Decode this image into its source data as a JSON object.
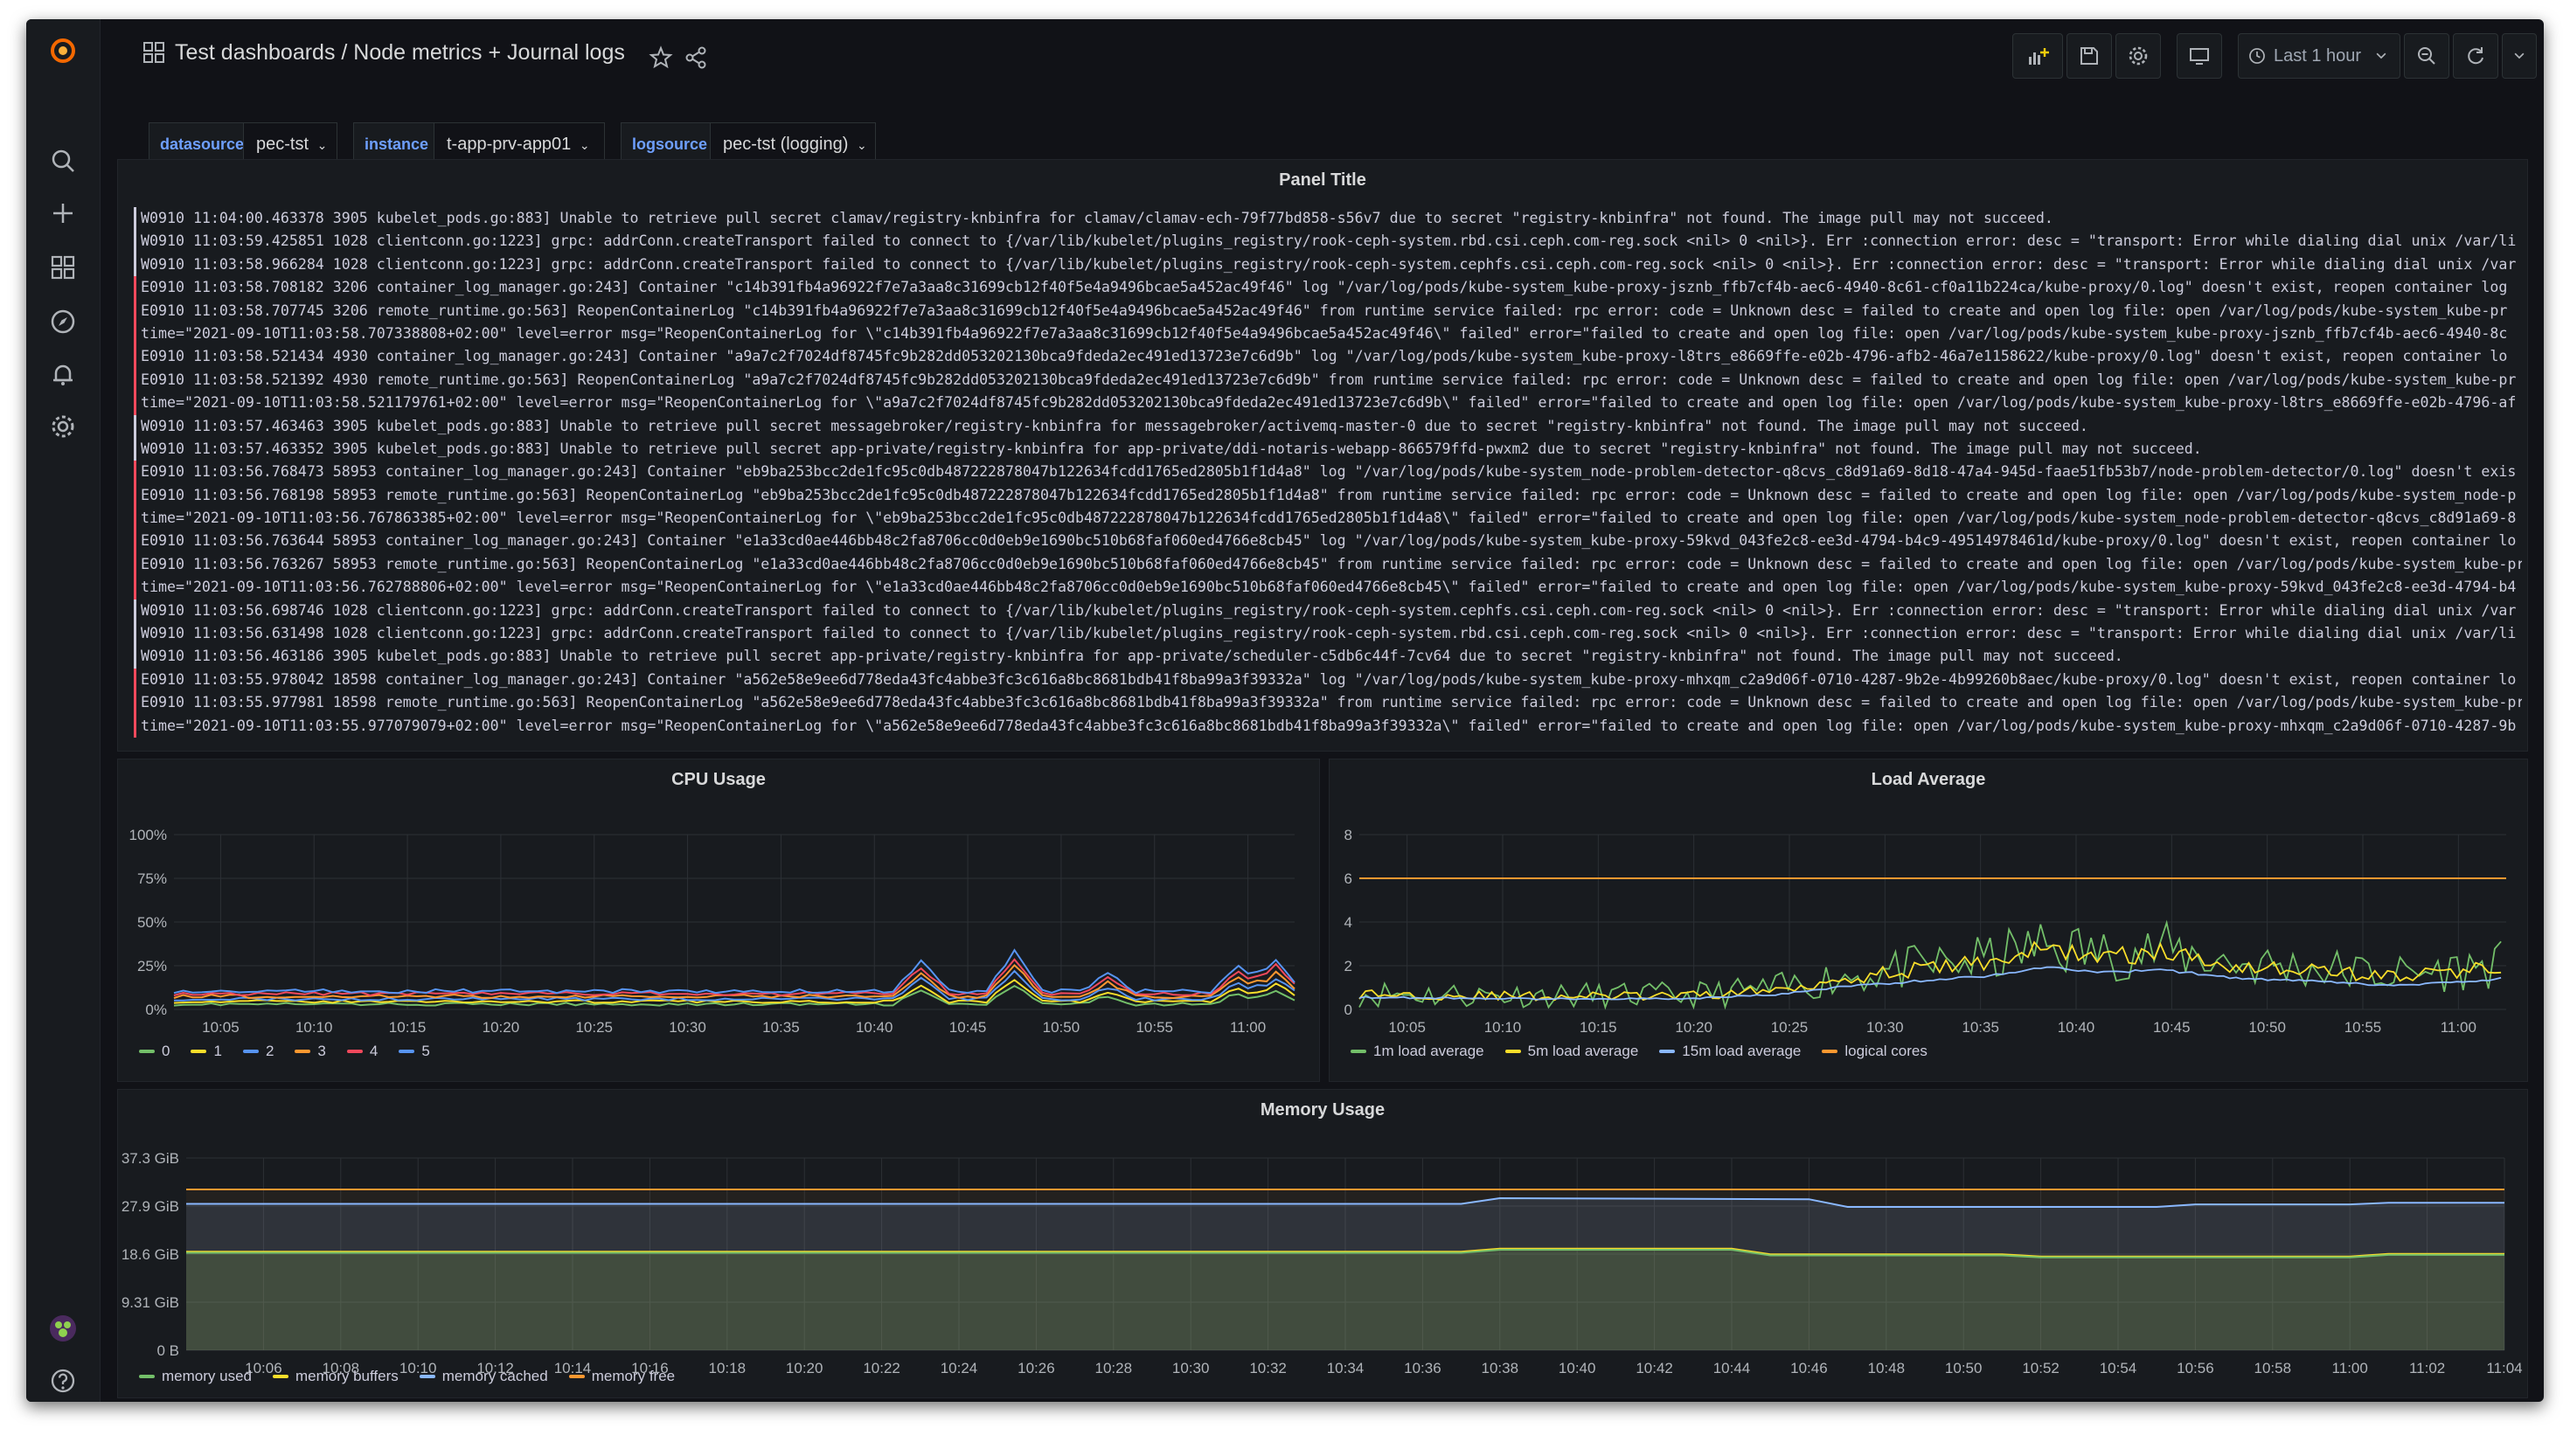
{
  "header": {
    "breadcrumb": "Test dashboards / Node metrics + Journal logs",
    "time_range_label": "Last 1 hour"
  },
  "icons": {
    "logo": "grafana-logo-icon",
    "search": "search-icon",
    "create": "plus-icon",
    "dashboards": "dashboards-grid-icon",
    "explore": "compass-icon",
    "alerting": "bell-icon",
    "configuration": "gear-icon",
    "profile": "avatar",
    "help": "help-icon"
  },
  "variables": [
    {
      "label": "datasource",
      "value": "pec-tst"
    },
    {
      "label": "instance",
      "value": "t-app-prv-app01"
    },
    {
      "label": "logsource",
      "value": "pec-tst (logging)"
    }
  ],
  "logs_panel": {
    "title": "Panel Title",
    "lines": [
      {
        "level": "warn",
        "text": "W0910 11:04:00.463378 3905 kubelet_pods.go:883] Unable to retrieve pull secret clamav/registry-knbinfra for clamav/clamav-ech-79f77bd858-s56v7 due to secret \"registry-knbinfra\" not found. The image pull may not succeed."
      },
      {
        "level": "warn",
        "text": "W0910 11:03:59.425851 1028 clientconn.go:1223] grpc: addrConn.createTransport failed to connect to {/var/lib/kubelet/plugins_registry/rook-ceph-system.rbd.csi.ceph.com-reg.sock <nil> 0 <nil>}. Err :connection error: desc = \"transport: Error while dialing dial unix /var/li"
      },
      {
        "level": "warn",
        "text": "W0910 11:03:58.966284 1028 clientconn.go:1223] grpc: addrConn.createTransport failed to connect to {/var/lib/kubelet/plugins_registry/rook-ceph-system.cephfs.csi.ceph.com-reg.sock <nil> 0 <nil>}. Err :connection error: desc = \"transport: Error while dialing dial unix /var"
      },
      {
        "level": "error",
        "text": "E0910 11:03:58.708182 3206 container_log_manager.go:243] Container \"c14b391fb4a96922f7e7a3aa8c31699cb12f40f5e4a9496bcae5a452ac49f46\" log \"/var/log/pods/kube-system_kube-proxy-jsznb_ffb7cf4b-aec6-4940-8c61-cf0a11b224ca/kube-proxy/0.log\" doesn't exist, reopen container log"
      },
      {
        "level": "error",
        "text": "E0910 11:03:58.707745 3206 remote_runtime.go:563] ReopenContainerLog \"c14b391fb4a96922f7e7a3aa8c31699cb12f40f5e4a9496bcae5a452ac49f46\" from runtime service failed: rpc error: code = Unknown desc = failed to create and open log file: open /var/log/pods/kube-system_kube-pr"
      },
      {
        "level": "error",
        "text": "time=\"2021-09-10T11:03:58.707338808+02:00\" level=error msg=\"ReopenContainerLog for \\\"c14b391fb4a96922f7e7a3aa8c31699cb12f40f5e4a9496bcae5a452ac49f46\\\" failed\" error=\"failed to create and open log file: open /var/log/pods/kube-system_kube-proxy-jsznb_ffb7cf4b-aec6-4940-8c"
      },
      {
        "level": "error",
        "text": "E0910 11:03:58.521434 4930 container_log_manager.go:243] Container \"a9a7c2f7024df8745fc9b282dd053202130bca9fdeda2ec491ed13723e7c6d9b\" log \"/var/log/pods/kube-system_kube-proxy-l8trs_e8669ffe-e02b-4796-afb2-46a7e1158622/kube-proxy/0.log\" doesn't exist, reopen container lo"
      },
      {
        "level": "error",
        "text": "E0910 11:03:58.521392 4930 remote_runtime.go:563] ReopenContainerLog \"a9a7c2f7024df8745fc9b282dd053202130bca9fdeda2ec491ed13723e7c6d9b\" from runtime service failed: rpc error: code = Unknown desc = failed to create and open log file: open /var/log/pods/kube-system_kube-pr"
      },
      {
        "level": "error",
        "text": "time=\"2021-09-10T11:03:58.521179761+02:00\" level=error msg=\"ReopenContainerLog for \\\"a9a7c2f7024df8745fc9b282dd053202130bca9fdeda2ec491ed13723e7c6d9b\\\" failed\" error=\"failed to create and open log file: open /var/log/pods/kube-system_kube-proxy-l8trs_e8669ffe-e02b-4796-af"
      },
      {
        "level": "warn",
        "text": "W0910 11:03:57.463463 3905 kubelet_pods.go:883] Unable to retrieve pull secret messagebroker/registry-knbinfra for messagebroker/activemq-master-0 due to secret \"registry-knbinfra\" not found. The image pull may not succeed."
      },
      {
        "level": "warn",
        "text": "W0910 11:03:57.463352 3905 kubelet_pods.go:883] Unable to retrieve pull secret app-private/registry-knbinfra for app-private/ddi-notaris-webapp-866579ffd-pwxm2 due to secret \"registry-knbinfra\" not found. The image pull may not succeed."
      },
      {
        "level": "error",
        "text": "E0910 11:03:56.768473 58953 container_log_manager.go:243] Container \"eb9ba253bcc2de1fc95c0db487222878047b122634fcdd1765ed2805b1f1d4a8\" log \"/var/log/pods/kube-system_node-problem-detector-q8cvs_c8d91a69-8d18-47a4-945d-faae51fb53b7/node-problem-detector/0.log\" doesn't exis"
      },
      {
        "level": "error",
        "text": "E0910 11:03:56.768198 58953 remote_runtime.go:563] ReopenContainerLog \"eb9ba253bcc2de1fc95c0db487222878047b122634fcdd1765ed2805b1f1d4a8\" from runtime service failed: rpc error: code = Unknown desc = failed to create and open log file: open /var/log/pods/kube-system_node-p"
      },
      {
        "level": "error",
        "text": "time=\"2021-09-10T11:03:56.767863385+02:00\" level=error msg=\"ReopenContainerLog for \\\"eb9ba253bcc2de1fc95c0db487222878047b122634fcdd1765ed2805b1f1d4a8\\\" failed\" error=\"failed to create and open log file: open /var/log/pods/kube-system_node-problem-detector-q8cvs_c8d91a69-8"
      },
      {
        "level": "error",
        "text": "E0910 11:03:56.763644 58953 container_log_manager.go:243] Container \"e1a33cd0ae446bb48c2fa8706cc0d0eb9e1690bc510b68faf060ed4766e8cb45\" log \"/var/log/pods/kube-system_kube-proxy-59kvd_043fe2c8-ee3d-4794-b4c9-49514978461d/kube-proxy/0.log\" doesn't exist, reopen container lo"
      },
      {
        "level": "error",
        "text": "E0910 11:03:56.763267 58953 remote_runtime.go:563] ReopenContainerLog \"e1a33cd0ae446bb48c2fa8706cc0d0eb9e1690bc510b68faf060ed4766e8cb45\" from runtime service failed: rpc error: code = Unknown desc = failed to create and open log file: open /var/log/pods/kube-system_kube-pr"
      },
      {
        "level": "error",
        "text": "time=\"2021-09-10T11:03:56.762788806+02:00\" level=error msg=\"ReopenContainerLog for \\\"e1a33cd0ae446bb48c2fa8706cc0d0eb9e1690bc510b68faf060ed4766e8cb45\\\" failed\" error=\"failed to create and open log file: open /var/log/pods/kube-system_kube-proxy-59kvd_043fe2c8-ee3d-4794-b4"
      },
      {
        "level": "warn",
        "text": "W0910 11:03:56.698746 1028 clientconn.go:1223] grpc: addrConn.createTransport failed to connect to {/var/lib/kubelet/plugins_registry/rook-ceph-system.cephfs.csi.ceph.com-reg.sock <nil> 0 <nil>}. Err :connection error: desc = \"transport: Error while dialing dial unix /var"
      },
      {
        "level": "warn",
        "text": "W0910 11:03:56.631498 1028 clientconn.go:1223] grpc: addrConn.createTransport failed to connect to {/var/lib/kubelet/plugins_registry/rook-ceph-system.rbd.csi.ceph.com-reg.sock <nil> 0 <nil>}. Err :connection error: desc = \"transport: Error while dialing dial unix /var/li"
      },
      {
        "level": "warn",
        "text": "W0910 11:03:56.463186 3905 kubelet_pods.go:883] Unable to retrieve pull secret app-private/registry-knbinfra for app-private/scheduler-c5db6c44f-7cv64 due to secret \"registry-knbinfra\" not found. The image pull may not succeed."
      },
      {
        "level": "error",
        "text": "E0910 11:03:55.978042 18598 container_log_manager.go:243] Container \"a562e58e9ee6d778eda43fc4abbe3fc3c616a8bc8681bdb41f8ba99a3f39332a\" log \"/var/log/pods/kube-system_kube-proxy-mhxqm_c2a9d06f-0710-4287-9b2e-4b99260b8aec/kube-proxy/0.log\" doesn't exist, reopen container lo"
      },
      {
        "level": "error",
        "text": "E0910 11:03:55.977981 18598 remote_runtime.go:563] ReopenContainerLog \"a562e58e9ee6d778eda43fc4abbe3fc3c616a8bc8681bdb41f8ba99a3f39332a\" from runtime service failed: rpc error: code = Unknown desc = failed to create and open log file: open /var/log/pods/kube-system_kube-pr"
      },
      {
        "level": "error",
        "text": "time=\"2021-09-10T11:03:55.977079079+02:00\" level=error msg=\"ReopenContainerLog for \\\"a562e58e9ee6d778eda43fc4abbe3fc3c616a8bc8681bdb41f8ba99a3f39332a\\\" failed\" error=\"failed to create and open log file: open /var/log/pods/kube-system_kube-proxy-mhxqm_c2a9d06f-0710-4287-9b"
      }
    ]
  },
  "chart_data": [
    {
      "type": "line",
      "title": "CPU Usage",
      "x_ticks": [
        "10:05",
        "10:10",
        "10:15",
        "10:20",
        "10:25",
        "10:30",
        "10:35",
        "10:40",
        "10:45",
        "10:50",
        "10:55",
        "11:00"
      ],
      "x_range": [
        1,
        61
      ],
      "y_ticks": [
        "0%",
        "25%",
        "50%",
        "75%",
        "100%"
      ],
      "ylim": [
        0,
        100
      ],
      "series": [
        {
          "name": "0",
          "color": "#73bf69",
          "base": 3,
          "jitter": 0.8
        },
        {
          "name": "1",
          "color": "#fade2a",
          "base": 4.5,
          "jitter": 0.8
        },
        {
          "name": "2",
          "color": "#5794f2",
          "base": 6,
          "jitter": 0.9
        },
        {
          "name": "3",
          "color": "#ff9830",
          "base": 7.5,
          "jitter": 1
        },
        {
          "name": "4",
          "color": "#f2495c",
          "base": 9,
          "jitter": 1
        },
        {
          "name": "5",
          "color": "#5794f2",
          "base": 10.5,
          "jitter": 1.1
        }
      ],
      "spikes": [
        [
          41,
          17
        ],
        [
          46,
          23
        ],
        [
          51,
          10
        ],
        [
          58,
          14
        ],
        [
          60,
          18
        ]
      ],
      "legend": [
        "0",
        "1",
        "2",
        "3",
        "4",
        "5"
      ]
    },
    {
      "type": "line",
      "title": "Load Average",
      "x_ticks": [
        "10:05",
        "10:10",
        "10:15",
        "10:20",
        "10:25",
        "10:30",
        "10:35",
        "10:40",
        "10:45",
        "10:50",
        "10:55",
        "11:00"
      ],
      "x_range": [
        1,
        61
      ],
      "y_ticks": [
        "0",
        "2",
        "4",
        "6",
        "8"
      ],
      "ylim": [
        0,
        8
      ],
      "series": [
        {
          "name": "1m load average",
          "color": "#73bf69"
        },
        {
          "name": "5m load average",
          "color": "#fade2a"
        },
        {
          "name": "15m load average",
          "color": "#8ab8ff"
        },
        {
          "name": "logical cores",
          "color": "#ff9830"
        }
      ],
      "shape": [
        [
          1,
          0.7
        ],
        [
          10,
          0.6
        ],
        [
          18,
          0.6
        ],
        [
          23,
          0.9
        ],
        [
          26,
          1.4
        ],
        [
          30,
          1.8
        ],
        [
          34,
          2.2
        ],
        [
          37,
          2.8
        ],
        [
          40,
          2.4
        ],
        [
          43,
          2.6
        ],
        [
          47,
          2
        ],
        [
          51,
          1.8
        ],
        [
          55,
          1.5
        ],
        [
          58,
          1.7
        ],
        [
          61,
          2
        ]
      ],
      "cores": 6,
      "legend": [
        "1m load average",
        "5m load average",
        "15m load average",
        "logical cores"
      ]
    },
    {
      "type": "area",
      "title": "Memory Usage",
      "x_ticks": [
        "10:06",
        "10:08",
        "10:10",
        "10:12",
        "10:14",
        "10:16",
        "10:18",
        "10:20",
        "10:22",
        "10:24",
        "10:26",
        "10:28",
        "10:30",
        "10:32",
        "10:34",
        "10:36",
        "10:38",
        "10:40",
        "10:42",
        "10:44",
        "10:46",
        "10:48",
        "10:50",
        "10:52",
        "10:54",
        "10:56",
        "10:58",
        "11:00",
        "11:02",
        "11:04"
      ],
      "x_range": [
        4,
        64
      ],
      "y_ticks": [
        "0 B",
        "9.31 GiB",
        "18.6 GiB",
        "27.9 GiB",
        "37.3 GiB"
      ],
      "ylim": [
        0,
        37.3
      ],
      "series": [
        {
          "name": "memory used",
          "color": "#73bf69",
          "points": [
            [
              4,
              18.9
            ],
            [
              37,
              18.9
            ],
            [
              38,
              19.5
            ],
            [
              44,
              19.5
            ],
            [
              45,
              18.4
            ],
            [
              51,
              18.4
            ],
            [
              52,
              18
            ],
            [
              60,
              18
            ],
            [
              61,
              18.5
            ],
            [
              64,
              18.5
            ]
          ]
        },
        {
          "name": "memory buffers",
          "color": "#fade2a",
          "points": [
            [
              4,
              19.1
            ],
            [
              37,
              19.1
            ],
            [
              38,
              19.7
            ],
            [
              44,
              19.7
            ],
            [
              45,
              18.6
            ],
            [
              51,
              18.6
            ],
            [
              52,
              18.2
            ],
            [
              60,
              18.2
            ],
            [
              61,
              18.7
            ],
            [
              64,
              18.7
            ]
          ]
        },
        {
          "name": "memory cached",
          "color": "#8ab8ff",
          "points": [
            [
              4,
              28.4
            ],
            [
              37,
              28.4
            ],
            [
              38,
              29.5
            ],
            [
              46,
              29.3
            ],
            [
              47,
              27.8
            ],
            [
              55,
              27.8
            ],
            [
              56,
              28.3
            ],
            [
              60,
              28.3
            ],
            [
              61,
              28.6
            ],
            [
              64,
              28.6
            ]
          ]
        },
        {
          "name": "memory free",
          "color": "#ff9830",
          "points": [
            [
              4,
              31.2
            ],
            [
              64,
              31.2
            ]
          ]
        }
      ],
      "legend": [
        "memory used",
        "memory buffers",
        "memory cached",
        "memory free"
      ]
    }
  ]
}
